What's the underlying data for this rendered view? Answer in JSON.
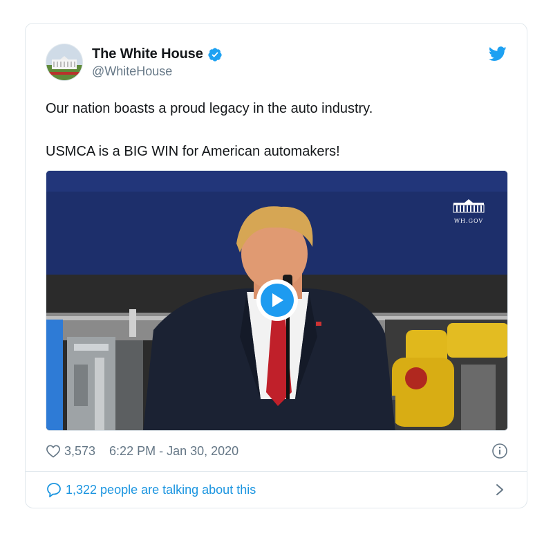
{
  "author": {
    "display_name": "The White House",
    "handle": "@WhiteHouse",
    "verified": true,
    "avatar_icon": "white-house-avatar"
  },
  "tweet": {
    "lines": [
      "Our nation boasts a proud legacy in the auto industry.",
      "USMCA is a BIG WIN for American automakers!"
    ]
  },
  "media": {
    "type": "video",
    "watermark": "WH.GOV",
    "play_icon": "play-icon"
  },
  "meta": {
    "like_count": "3,573",
    "timestamp": "6:22 PM - Jan 30, 2020",
    "like_icon": "heart-icon",
    "info_icon": "info-icon"
  },
  "footer": {
    "talking_text": "1,322 people are talking about this",
    "comment_icon": "comment-icon",
    "chevron_icon": "chevron-right-icon"
  },
  "colors": {
    "twitter_blue": "#1da1f2",
    "link_blue": "#1b95e0",
    "secondary_text": "#657786",
    "border": "#e1e8ed"
  }
}
